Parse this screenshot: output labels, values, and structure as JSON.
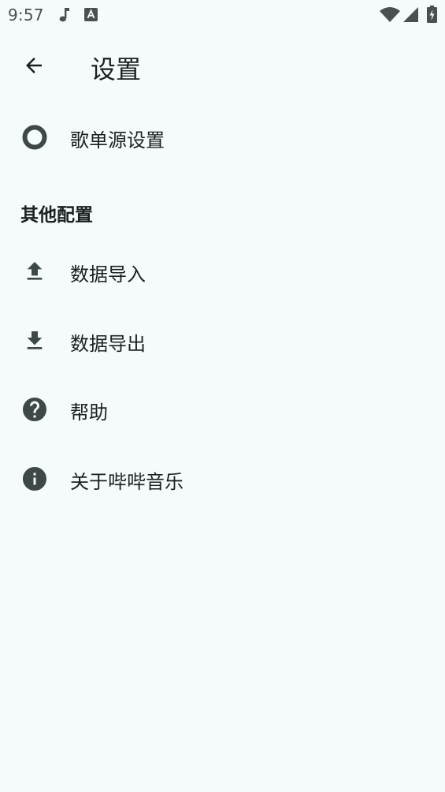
{
  "status_bar": {
    "time": "9:57",
    "left_icons": [
      "music-note-icon",
      "font-a-icon"
    ],
    "right_icons": [
      "wifi-icon",
      "cell-signal-icon",
      "battery-charging-icon"
    ]
  },
  "app_bar": {
    "back_icon": "arrow-left-icon",
    "title": "设置"
  },
  "items_top": [
    {
      "icon": "radio-ring-icon",
      "label": "歌单源设置"
    }
  ],
  "section": {
    "header": "其他配置",
    "items": [
      {
        "icon": "upload-icon",
        "label": "数据导入"
      },
      {
        "icon": "download-icon",
        "label": "数据导出"
      },
      {
        "icon": "help-circle-icon",
        "label": "帮助"
      },
      {
        "icon": "info-circle-icon",
        "label": "关于哔哔音乐"
      }
    ]
  },
  "colors": {
    "background": "#f5fbfb",
    "icon": "#3f4848",
    "text": "#1b1f1f"
  }
}
